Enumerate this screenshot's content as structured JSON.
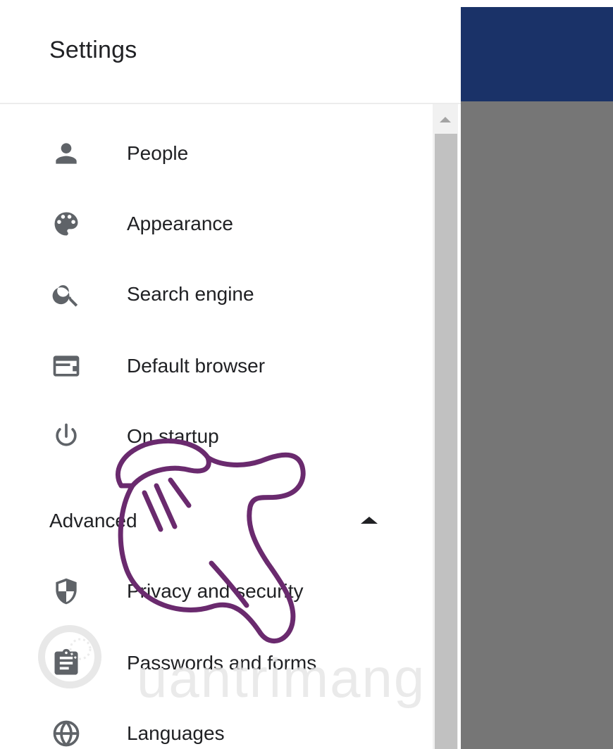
{
  "header": {
    "title": "Settings"
  },
  "menu": {
    "items": [
      {
        "label": "People",
        "icon": "person-icon"
      },
      {
        "label": "Appearance",
        "icon": "palette-icon"
      },
      {
        "label": "Search engine",
        "icon": "search-icon"
      },
      {
        "label": "Default browser",
        "icon": "browser-window-icon"
      },
      {
        "label": "On startup",
        "icon": "power-icon"
      }
    ],
    "advanced_label": "Advanced",
    "advanced_items": [
      {
        "label": "Privacy and security",
        "icon": "shield-icon"
      },
      {
        "label": "Passwords and forms",
        "icon": "clipboard-icon"
      },
      {
        "label": "Languages",
        "icon": "globe-icon"
      }
    ]
  },
  "watermark": {
    "text": "uantrimang"
  },
  "colors": {
    "header_blue": "#1a3268",
    "panel_gray": "#767676",
    "text": "#202124",
    "icon": "#5f6368",
    "hand_outline": "#6a2a6e"
  }
}
